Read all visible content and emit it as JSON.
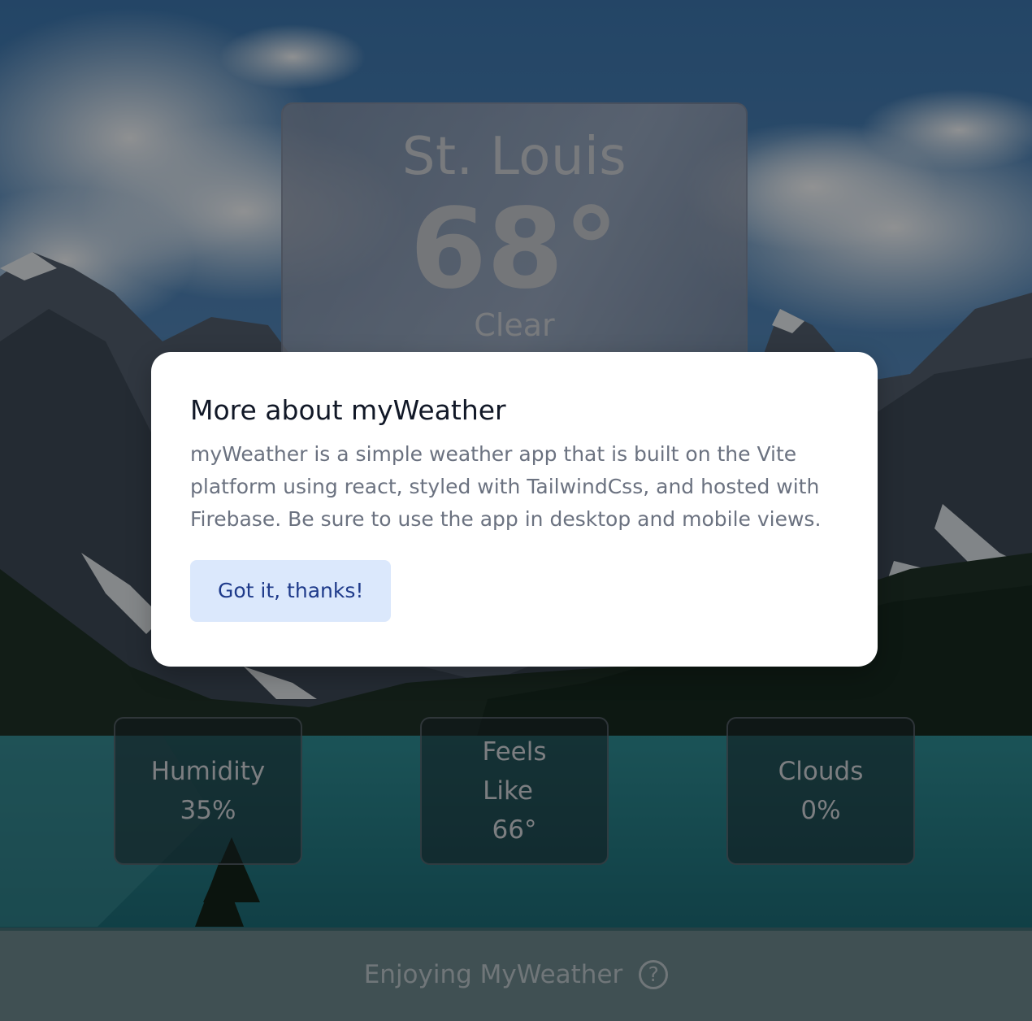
{
  "weather": {
    "city": "St. Louis",
    "temperature": "68°",
    "condition": "Clear"
  },
  "stats": {
    "humidity_label": "Humidity",
    "humidity_value": "35%",
    "feels_like_label_1": "Feels",
    "feels_like_label_2": "Like",
    "feels_like_value": "66°",
    "clouds_label": "Clouds",
    "clouds_value": "0%"
  },
  "footer": {
    "text": "Enjoying MyWeather",
    "help_icon": "question-circle-icon",
    "help_glyph": "?"
  },
  "modal": {
    "title": "More about myWeather",
    "body": "myWeather is a simple weather app that is built on the Vite platform using react, styled with TailwindCss, and hosted with Firebase. Be sure to use the app in desktop and mobile views.",
    "button_label": "Got it, thanks!"
  }
}
